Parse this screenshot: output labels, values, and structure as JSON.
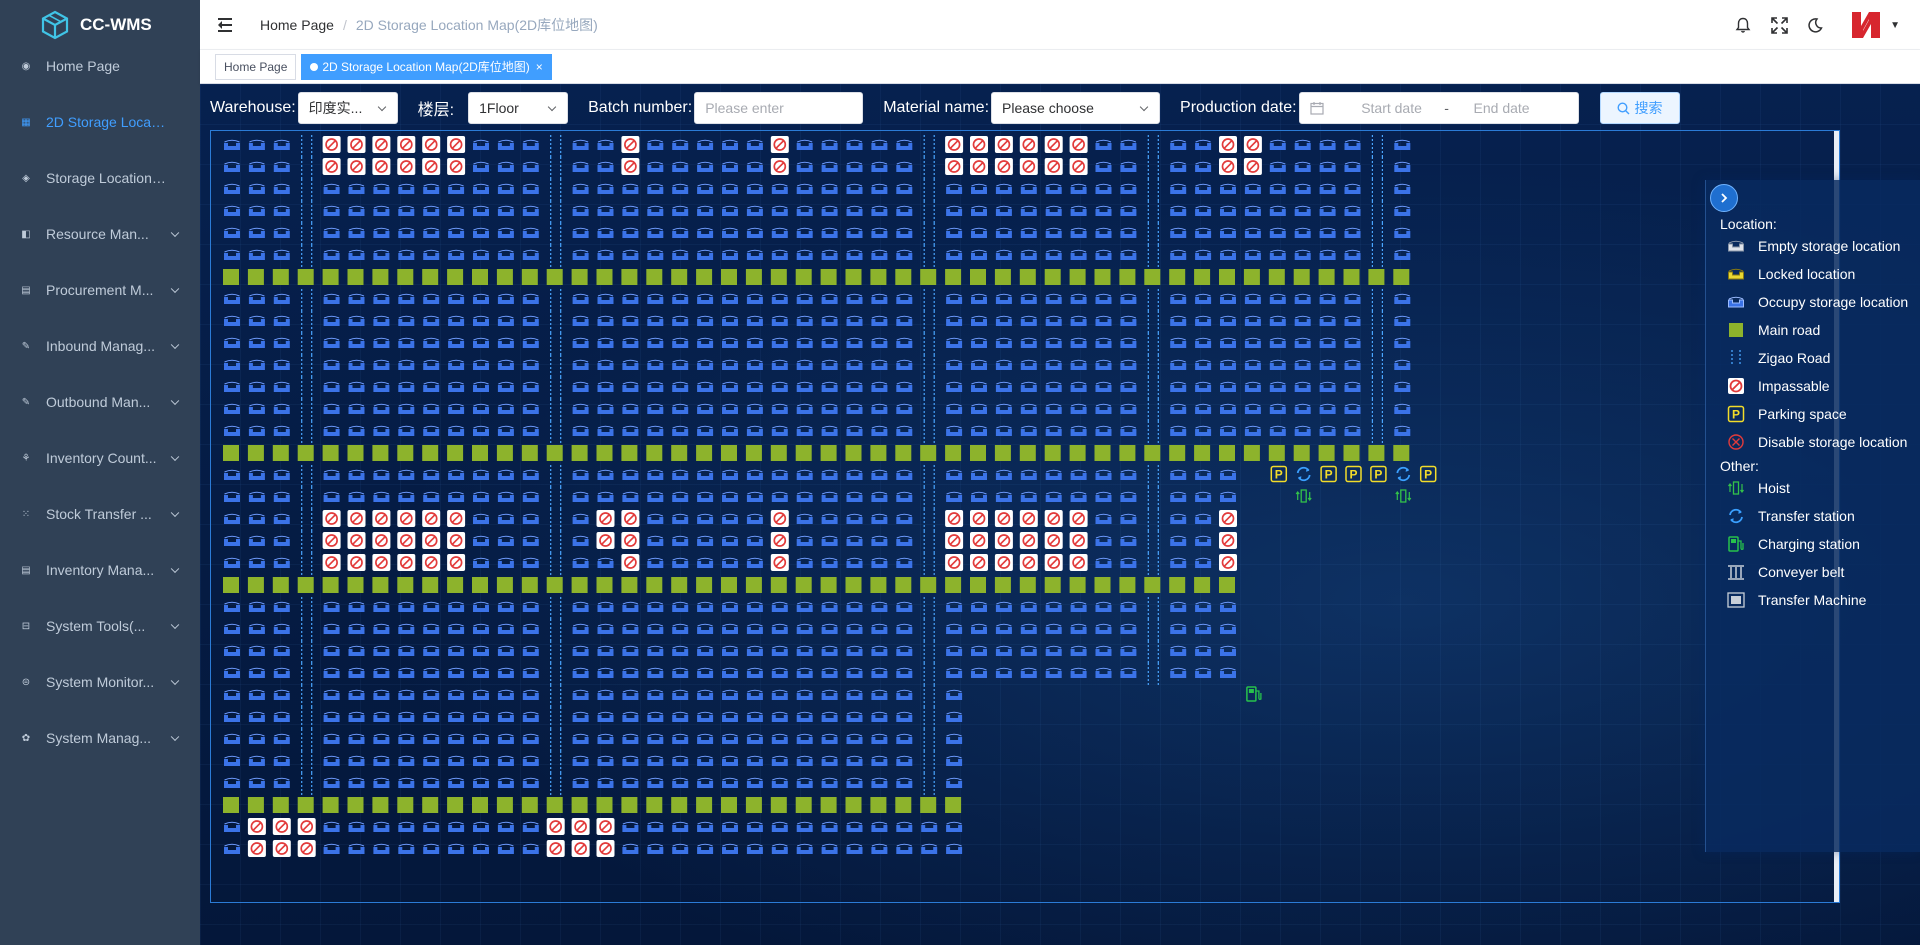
{
  "app": {
    "name": "CC-WMS"
  },
  "sidebar": {
    "items": [
      {
        "label": "Home Page",
        "icon": "dashboard-icon",
        "active": false,
        "has_children": false
      },
      {
        "label": "2D Storage Locatio...",
        "icon": "map-icon",
        "active": true,
        "has_children": false
      },
      {
        "label": "Storage Location ...",
        "icon": "location-icon",
        "active": false,
        "has_children": false
      },
      {
        "label": "Resource Man...",
        "icon": "resource-icon",
        "active": false,
        "has_children": true
      },
      {
        "label": "Procurement M...",
        "icon": "procurement-icon",
        "active": false,
        "has_children": true
      },
      {
        "label": "Inbound Manag...",
        "icon": "inbound-icon",
        "active": false,
        "has_children": true
      },
      {
        "label": "Outbound Man...",
        "icon": "outbound-icon",
        "active": false,
        "has_children": true
      },
      {
        "label": "Inventory Count...",
        "icon": "inventory-count-icon",
        "active": false,
        "has_children": true
      },
      {
        "label": "Stock Transfer ...",
        "icon": "stock-transfer-icon",
        "active": false,
        "has_children": true
      },
      {
        "label": "Inventory Mana...",
        "icon": "inventory-icon",
        "active": false,
        "has_children": true
      },
      {
        "label": "System Tools(...",
        "icon": "tools-icon",
        "active": false,
        "has_children": true
      },
      {
        "label": "System Monitor...",
        "icon": "monitor-icon",
        "active": false,
        "has_children": true
      },
      {
        "label": "System Manag...",
        "icon": "settings-icon",
        "active": false,
        "has_children": true
      }
    ]
  },
  "header": {
    "breadcrumb": [
      "Home Page",
      "2D Storage Location Map(2D库位地图)"
    ],
    "icons": [
      "bell-icon",
      "fullscreen-icon",
      "moon-icon"
    ]
  },
  "tags": [
    {
      "label": "Home Page",
      "active": false
    },
    {
      "label": "2D Storage Location Map(2D库位地图)",
      "active": true
    }
  ],
  "filters": {
    "warehouse_label": "Warehouse:",
    "warehouse_value": "印度实...",
    "floor_label": "楼层:",
    "floor_value": "1Floor",
    "batch_label": "Batch number:",
    "batch_placeholder": "Please enter",
    "material_label": "Material name:",
    "material_placeholder": "Please choose",
    "date_label": "Production date:",
    "date_start": "Start date",
    "date_sep": "-",
    "date_end": "End date",
    "search_label": "搜索"
  },
  "legend": {
    "location_title": "Location:",
    "location_items": [
      {
        "key": "empty",
        "label": "Empty storage location"
      },
      {
        "key": "locked",
        "label": "Locked location"
      },
      {
        "key": "occupy",
        "label": "Occupy storage location"
      },
      {
        "key": "mainroad",
        "label": "Main road"
      },
      {
        "key": "zigao",
        "label": "Zigao Road"
      },
      {
        "key": "impassable",
        "label": "Impassable"
      },
      {
        "key": "parking",
        "label": "Parking space"
      },
      {
        "key": "disable",
        "label": "Disable storage location"
      }
    ],
    "other_title": "Other:",
    "other_items": [
      {
        "key": "hoist",
        "label": "Hoist"
      },
      {
        "key": "transfer",
        "label": "Transfer station"
      },
      {
        "key": "charging",
        "label": "Charging station"
      },
      {
        "key": "conveyor",
        "label": "Conveyer belt"
      },
      {
        "key": "machine",
        "label": "Transfer Machine"
      }
    ]
  },
  "colors": {
    "sidebar_bg": "#304156",
    "accent": "#409eff",
    "map_bg": "#041e4a",
    "occupied": "#3b73e8",
    "main_road": "#8db32c",
    "impassable": "#e23b3b",
    "parking": "#f2dc2a",
    "charging": "#27c24c"
  }
}
